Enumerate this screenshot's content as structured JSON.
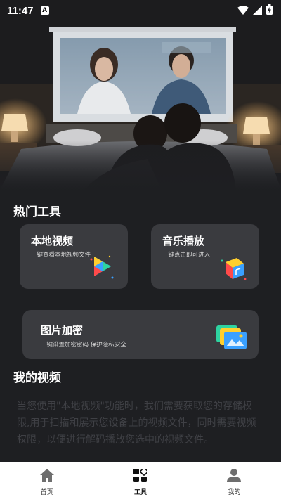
{
  "status_bar": {
    "time": "11:47",
    "indicator": "A",
    "icons": [
      "wifi-icon",
      "signal-icon",
      "battery-charging-icon"
    ]
  },
  "hot_tools": {
    "title": "热门工具",
    "cards": [
      {
        "title": "本地视频",
        "subtitle": "一键查看本地视频文件",
        "icon": "video-play-icon"
      },
      {
        "title": "音乐播放",
        "subtitle": "一键点击即可进入",
        "icon": "music-player-icon"
      },
      {
        "title": "图片加密",
        "subtitle": "一键设置加密密码  保护隐私安全",
        "icon": "photo-gallery-icon"
      }
    ]
  },
  "my_videos": {
    "title": "我的视频",
    "notice": "当您使用\"本地视频\"功能时，我们需要获取您的存储权限,用于扫描和展示您设备上的视频文件，同时需要视频权限，以便进行解码播放您选中的视频文件。"
  },
  "bottom_nav": {
    "items": [
      {
        "label": "首页",
        "icon": "home-icon",
        "active": false
      },
      {
        "label": "工具",
        "icon": "tools-grid-icon",
        "active": true
      },
      {
        "label": "我的",
        "icon": "profile-icon",
        "active": false
      }
    ]
  },
  "colors": {
    "background": "#1e1f22",
    "card": "#3a3b3f",
    "nav_background": "#ffffff"
  }
}
